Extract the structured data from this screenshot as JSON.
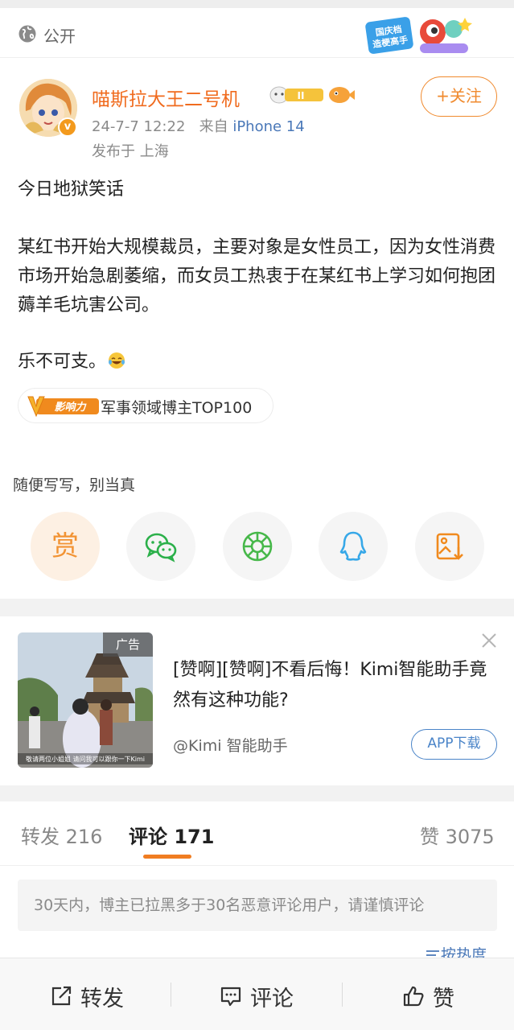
{
  "header": {
    "visibility_label": "公开"
  },
  "author": {
    "name": "喵斯拉大王二号机",
    "time": "24-7-7 12:22",
    "source_prefix": "来自",
    "device": "iPhone 14",
    "location": "发布于 上海",
    "follow_label": "+关注",
    "verified_mark": "v",
    "level_badge": "II"
  },
  "post": {
    "line1": "今日地狱笑话",
    "line2": "某红书开始大规模裁员，主要对象是女性员工，因为女性消费市场开始急剧萎缩，而女员工热衷于在某红书上学习如何抱团薅羊毛坑害公司。",
    "line3": "乐不可支。"
  },
  "influence": {
    "icon_text": "影响力",
    "label": "军事领域博主TOP100"
  },
  "caption": "随便写写，别当真",
  "share": {
    "reward_label": "赏",
    "items": [
      "reward-icon",
      "wechat-icon",
      "moments-icon",
      "qq-icon",
      "save-image-icon"
    ]
  },
  "ad": {
    "tag": "广告",
    "title": "[赞啊][赞啊]不看后悔！Kimi智能助手竟然有这种功能?",
    "source": "@Kimi 智能助手",
    "cta": "APP下载",
    "image_caption": "敬请两位小姐姐 请问我可以跟你一下Kimi"
  },
  "tabs": {
    "repost": "转发 216",
    "comment": "评论 171",
    "like": "赞 3075"
  },
  "notice": "30天内，博主已拉黑多于30名恶意评论用户，请谨慎评论",
  "sort_label": "按热度",
  "bottom_bar": {
    "repost": "转发",
    "comment": "评论",
    "like": "赞"
  },
  "colors": {
    "accent_orange": "#f07d21",
    "username": "#f06b1e",
    "link_blue": "#4a78b8"
  }
}
